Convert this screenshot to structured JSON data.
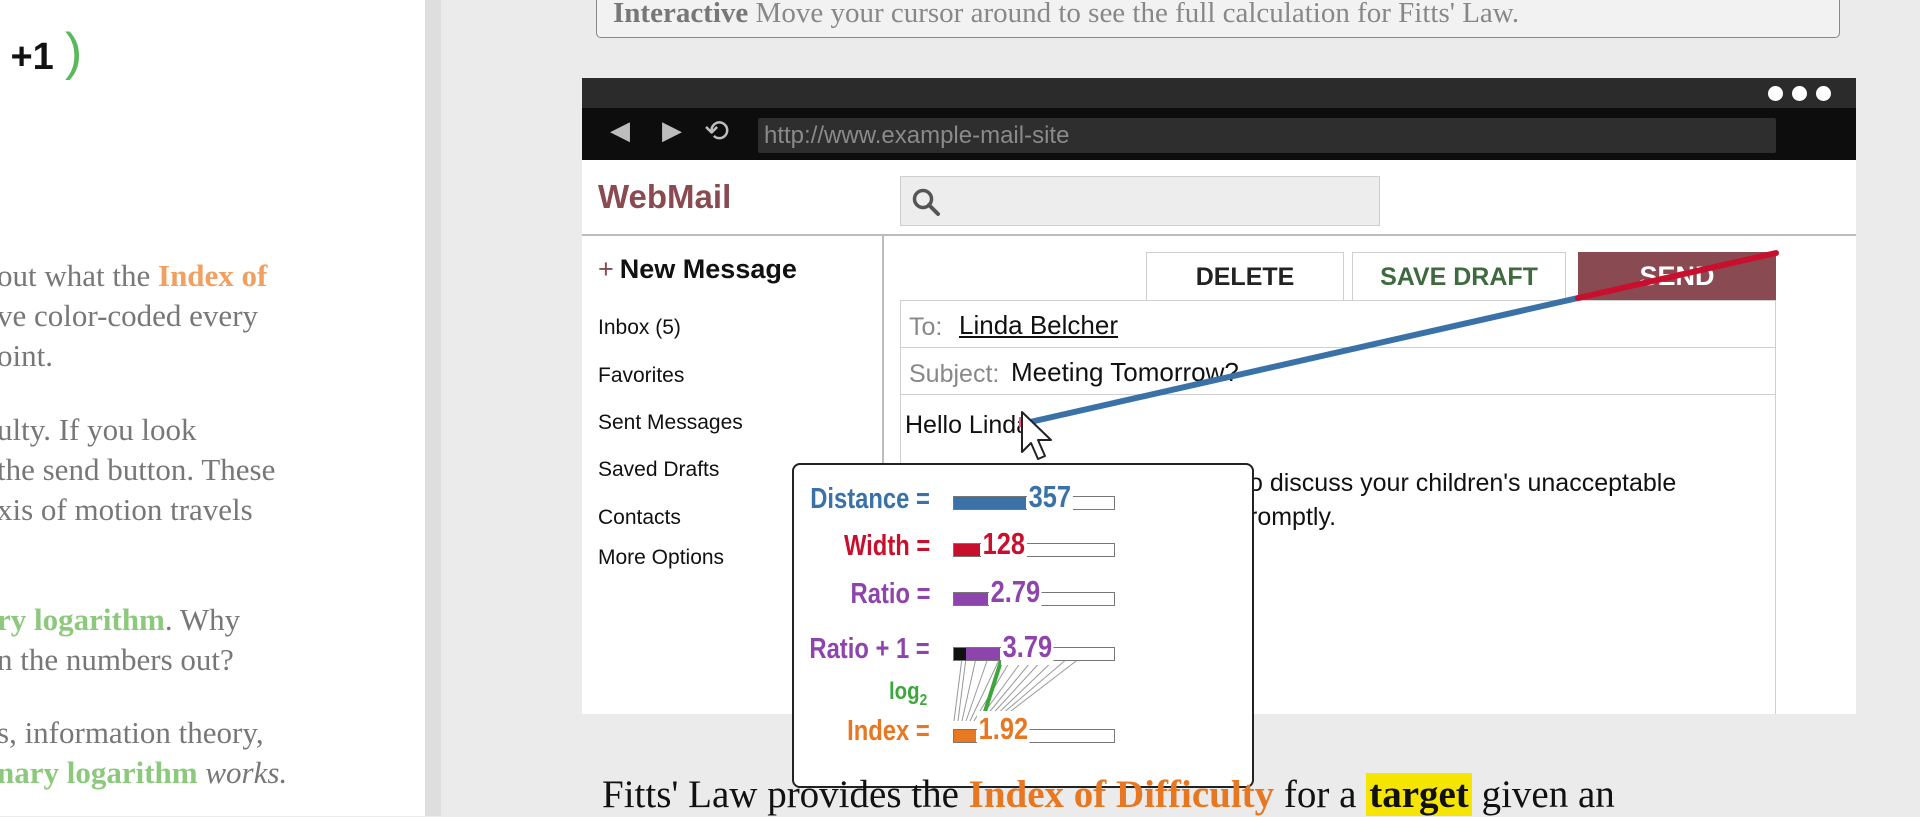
{
  "left_column": {
    "formula_fragment": {
      "paren_char": ")",
      "plus_one": "+1",
      "close_paren": ")"
    },
    "p1": {
      "line1_pre": "out what the ",
      "line1_hl": "Index of",
      "line2": "ve color-coded every",
      "line3": "oint."
    },
    "p2": {
      "line1": "ulty. If you look",
      "line2": "the send button. These",
      "line3": "xis of motion travels"
    },
    "p3": {
      "line1_hl": "ry logarithm",
      "line1_post": ". Why",
      "line2": "n the numbers out?"
    },
    "p4": {
      "line1": "s, information theory,",
      "line2_hl": "nary logarithm",
      "line2_post": "works."
    }
  },
  "callout": {
    "bold": "Interactive",
    "text": " Move your cursor around to see the full calculation for Fitts' Law."
  },
  "browser": {
    "url": "http://www.example-mail-site",
    "nav": {
      "back_icon": "◀",
      "forward_icon": "▶",
      "reload_icon": "⟲"
    }
  },
  "mail": {
    "logo": "WebMail",
    "new_message": "New Message",
    "new_message_plus": "+",
    "sidebar": [
      "Inbox (5)",
      "Favorites",
      "Sent Messages",
      "Saved Drafts",
      "Contacts",
      "More Options"
    ],
    "buttons": {
      "delete": "DELETE",
      "save_draft": "SAVE DRAFT",
      "send": "SEND"
    },
    "to_label": "To:",
    "to_value": "Linda Belcher",
    "subject_label": "Subject:",
    "subject_value": "Meeting Tomorrow?",
    "greeting": "Hello Linda",
    "body_line1": "o discuss your children's unacceptable",
    "body_line2": "romptly."
  },
  "calculation": {
    "distance": {
      "label": "Distance =",
      "value": "357",
      "fill": 0.45
    },
    "width": {
      "label": "Width =",
      "value": "128",
      "fill": 0.16
    },
    "ratio": {
      "label": "Ratio =",
      "value": "2.79",
      "fill": 0.21
    },
    "ratio_plus_one": {
      "label": "Ratio + 1 =",
      "value": "3.79",
      "fill": 0.29
    },
    "log_label": "log",
    "log_sub": "2",
    "index": {
      "label": "Index =",
      "value": "1.92",
      "fill": 0.14
    }
  },
  "bottom_text": {
    "pre": "Fitts' Law provides the ",
    "hl": "Index of Difficulty",
    "mid": " for a ",
    "target": "target",
    "post": " given an"
  },
  "colors": {
    "distance": "#3a72a8",
    "width": "#c8102e",
    "ratio": "#8e44ad",
    "log": "#3da63d",
    "index": "#e87722",
    "send_button": "#8a4a52"
  }
}
